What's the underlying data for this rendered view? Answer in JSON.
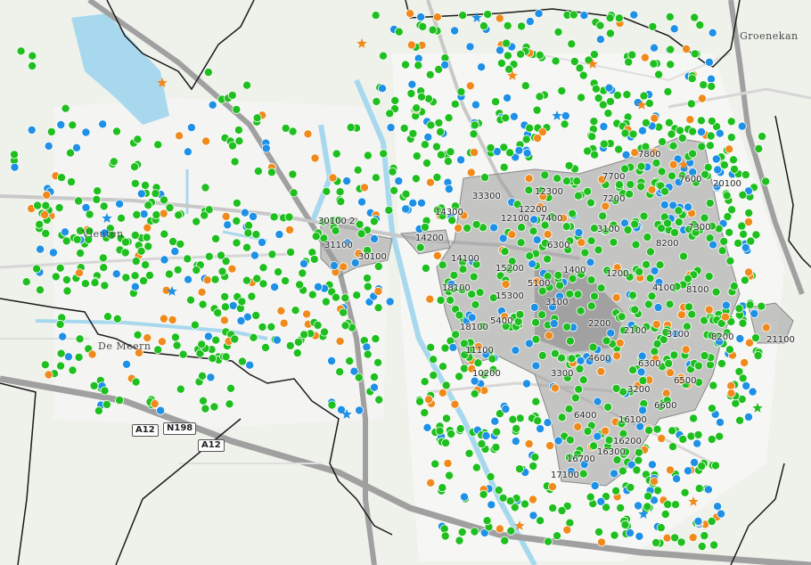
{
  "map": {
    "place_labels": [
      "Groenekan",
      "Vleuten",
      "De Meern"
    ],
    "road_shields": [
      "A12",
      "N198",
      "A12"
    ],
    "postcode_labels": [
      "30100 2",
      "31100",
      "30100",
      "14200",
      "14300",
      "33300",
      "12300",
      "12100",
      "12200",
      "7400",
      "7700",
      "7800",
      "7600",
      "20100",
      "7200",
      "3100",
      "8200",
      "7300",
      "6300",
      "14100",
      "15200",
      "1400",
      "1200",
      "18100",
      "15300",
      "5100",
      "4100",
      "8100",
      "3100",
      "18100",
      "5400",
      "2200",
      "2100",
      "3100",
      "8200",
      "21100",
      "11100",
      "4600",
      "6300",
      "10200",
      "3300",
      "3200",
      "6500",
      "6600",
      "6400",
      "16100",
      "16200",
      "16300",
      "16700",
      "17100"
    ],
    "colors": {
      "point_green": "#1fbf1f",
      "point_blue": "#1e90e6",
      "point_orange": "#f08a1c",
      "star_orange": "#f08a1c",
      "star_blue": "#1e90e6",
      "district_fill": "#9a9a9a",
      "boundary": "#1a1a1a",
      "water": "#a8d8ee",
      "motorway": "#9c9c9c"
    },
    "legend_categories": [
      "green-point",
      "blue-point",
      "orange-point",
      "orange-star",
      "blue-star"
    ]
  }
}
